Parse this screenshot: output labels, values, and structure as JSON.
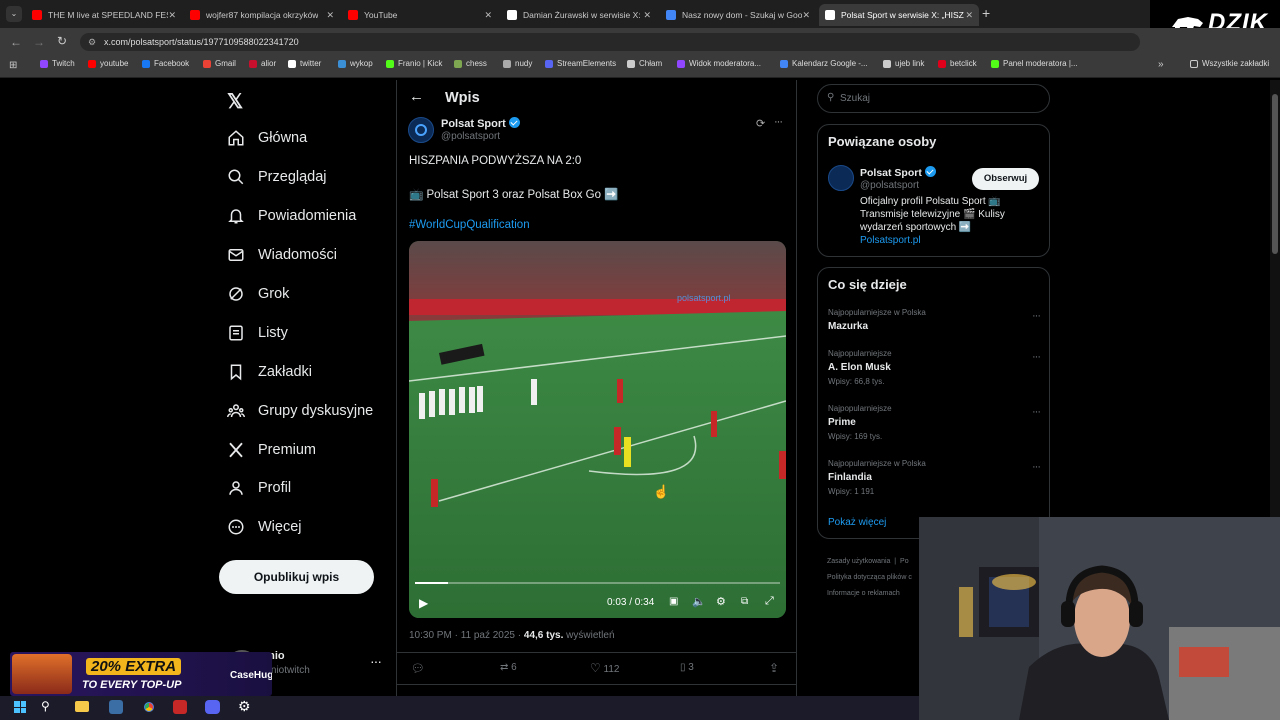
{
  "browser": {
    "tabs": [
      {
        "title": "THE M live at SPEEDLAND FEST",
        "favicon_color": "#ff0000"
      },
      {
        "title": "wojfer87 kompilacja okrzyków",
        "favicon_color": "#ff0000"
      },
      {
        "title": "YouTube",
        "favicon_color": "#ff0000"
      },
      {
        "title": "Damian Żurawski w serwisie X:",
        "favicon_color": "#ffffff"
      },
      {
        "title": "Nasz nowy dom - Szukaj w Goo",
        "favicon_color": "#4285f4"
      },
      {
        "title": "Polsat Sport w serwisie X: „HISZ",
        "favicon_color": "#ffffff"
      }
    ],
    "url": "x.com/polsatsport/status/1977109588022341720",
    "bookmarks": [
      {
        "label": "Twitch",
        "color": "#9146ff"
      },
      {
        "label": "youtube",
        "color": "#ff0000"
      },
      {
        "label": "Facebook",
        "color": "#1877f2"
      },
      {
        "label": "Gmail",
        "color": "#ea4335"
      },
      {
        "label": "alior",
        "color": "#c8102e"
      },
      {
        "label": "twitter",
        "color": "#ffffff"
      },
      {
        "label": "wykop",
        "color": "#3b8fd4"
      },
      {
        "label": "Franio | Kick",
        "color": "#53fc18"
      },
      {
        "label": "chess",
        "color": "#7fa650"
      },
      {
        "label": "nudy",
        "color": "#aaaaaa"
      },
      {
        "label": "StreamElements",
        "color": "#5865f2"
      },
      {
        "label": "Chłam",
        "color": "#cccccc"
      },
      {
        "label": "Widok moderatora...",
        "color": "#9146ff"
      },
      {
        "label": "Kalendarz Google -...",
        "color": "#4285f4"
      },
      {
        "label": "ujeb link",
        "color": "#cccccc"
      },
      {
        "label": "betclick",
        "color": "#e0001b"
      },
      {
        "label": "Panel moderatora |...",
        "color": "#53fc18"
      }
    ],
    "all_bookmarks": "Wszystkie zakładki"
  },
  "overlay": {
    "brand": "DZIK"
  },
  "nav": {
    "items": [
      {
        "label": "Główna",
        "icon": "home-icon"
      },
      {
        "label": "Przeglądaj",
        "icon": "search-icon"
      },
      {
        "label": "Powiadomienia",
        "icon": "bell-icon"
      },
      {
        "label": "Wiadomości",
        "icon": "mail-icon"
      },
      {
        "label": "Grok",
        "icon": "grok-icon"
      },
      {
        "label": "Listy",
        "icon": "list-icon"
      },
      {
        "label": "Zakładki",
        "icon": "bookmark-icon"
      },
      {
        "label": "Grupy dyskusyjne",
        "icon": "people-icon"
      },
      {
        "label": "Premium",
        "icon": "x-logo-icon"
      },
      {
        "label": "Profil",
        "icon": "person-icon"
      },
      {
        "label": "Więcej",
        "icon": "more-icon"
      }
    ],
    "post_button": "Opublikuj wpis",
    "account": {
      "name": "anio",
      "handle": "raniotwitch"
    }
  },
  "post": {
    "header": "Wpis",
    "author": "Polsat Sport",
    "handle": "@polsatsport",
    "text1": "HISZPANIA PODWYŻSZA NA 2:0",
    "text2": "📺 Polsat Sport 3 oraz Polsat Box Go ➡️",
    "hashtag": "#WorldCupQualification",
    "video": {
      "time": "0:03 / 0:34",
      "progress": 0.09,
      "watermark": "polsatsport.pl"
    },
    "timestamp": "10:30 PM · 11 paź 2025 · ",
    "views": "44,6 tys.",
    "views_label": " wyświetleń",
    "replies": "",
    "reposts": "6",
    "likes": "112",
    "bookmarks": "3"
  },
  "search": {
    "placeholder": "Szukaj"
  },
  "related": {
    "title": "Powiązane osoby",
    "name": "Polsat Sport",
    "handle": "@polsatsport",
    "follow": "Obserwuj",
    "bio": "Oficjalny profil Polsatu Sport 📺 Transmisje telewizyjne 🎬 Kulisy wydarzeń sportowych ➡️",
    "link": "Polsatsport.pl"
  },
  "trends": {
    "title": "Co się dzieje",
    "items": [
      {
        "meta": "Najpopularniejsze w Polska",
        "name": "Mazurka",
        "count": ""
      },
      {
        "meta": "Najpopularniejsze",
        "name": "A. Elon Musk",
        "count": "Wpisy: 66,8 tys."
      },
      {
        "meta": "Najpopularniejsze",
        "name": "Prime",
        "count": "Wpisy: 169 tys."
      },
      {
        "meta": "Najpopularniejsze w Polska",
        "name": "Finlandia",
        "count": "Wpisy: 1 191"
      }
    ],
    "show_more": "Pokaż więcej"
  },
  "footer": {
    "l1": "Zasady użytkowania",
    "l1b": "Po",
    "l2": "Polityka dotycząca plików c",
    "l3": "Informacje o reklamach"
  },
  "ad": {
    "line1": "20% EXTRA",
    "line2": "TO EVERY TOP-UP",
    "brand": "CaseHug"
  }
}
